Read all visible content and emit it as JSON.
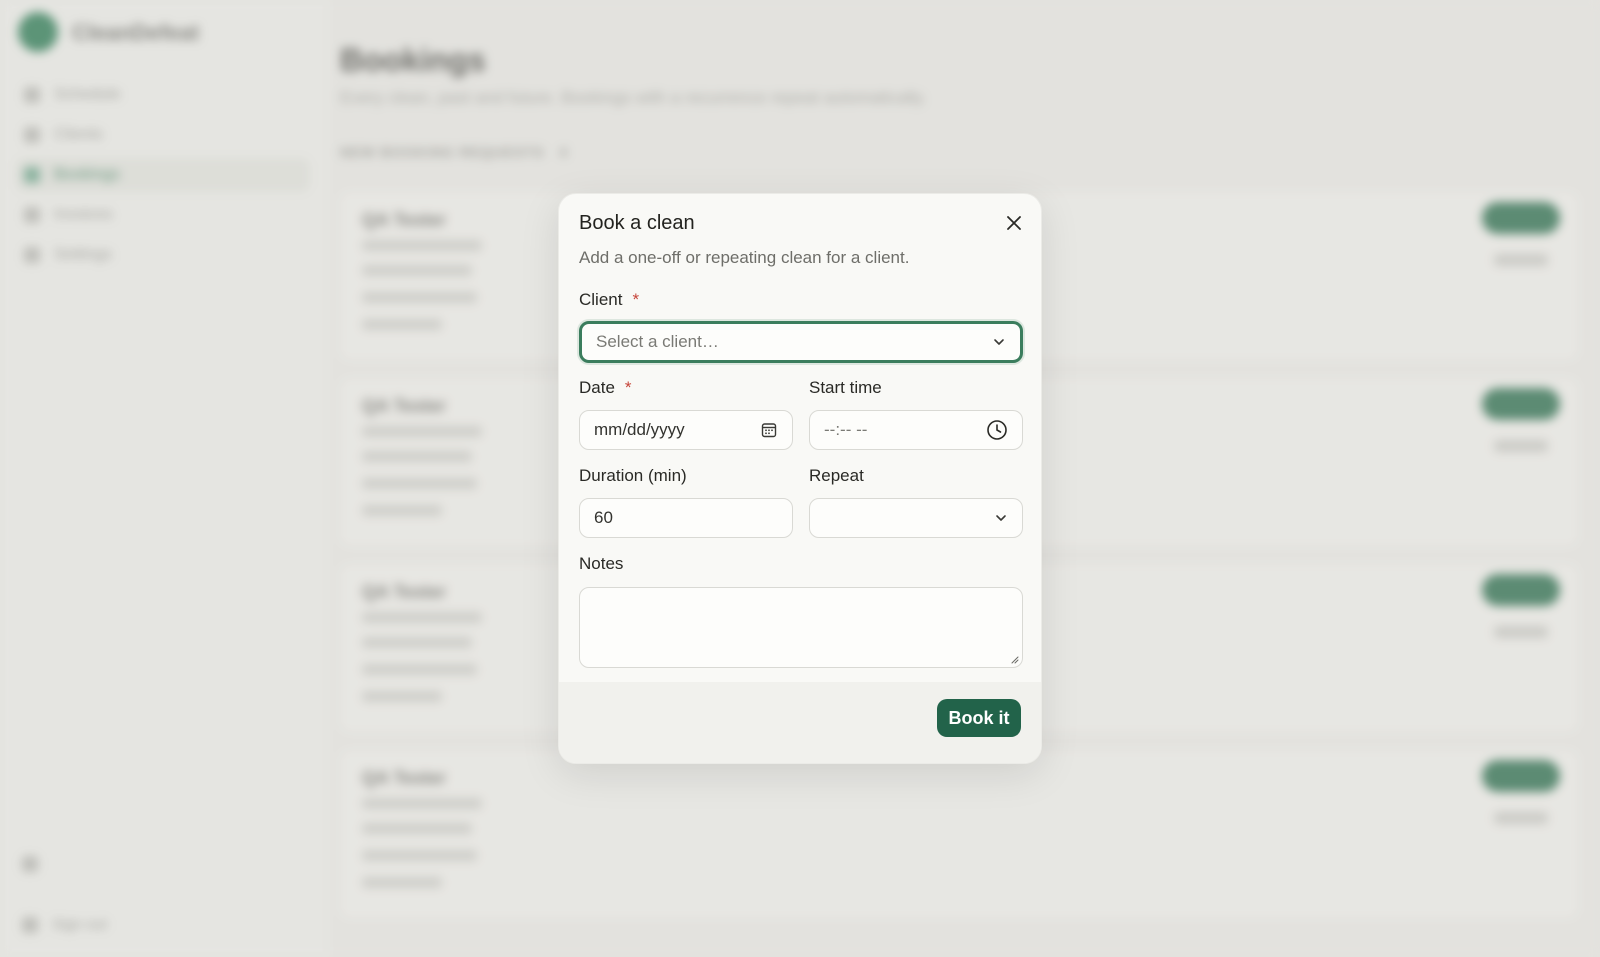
{
  "app": {
    "brand": "CleanDefeat",
    "nav": [
      {
        "label": "Schedule"
      },
      {
        "label": "Clients"
      },
      {
        "label": "Bookings"
      },
      {
        "label": "Invoices"
      },
      {
        "label": "Settings"
      }
    ],
    "signout": "Sign out"
  },
  "page": {
    "title": "Bookings",
    "subtitle": "Every clean, past and future. Bookings with a recurrence repeat automatically.",
    "section_label": "NEW BOOKING REQUESTS",
    "section_count": "4",
    "cards": [
      {
        "name": "QA Tester"
      },
      {
        "name": "QA Tester"
      },
      {
        "name": "QA Tester"
      },
      {
        "name": "QA Tester"
      }
    ]
  },
  "modal": {
    "title": "Book a clean",
    "subtitle": "Add a one-off or repeating clean for a client.",
    "client_label": "Client",
    "client_placeholder": "Select a client…",
    "date_label": "Date",
    "date_placeholder": "mm/dd/yyyy",
    "start_time_label": "Start time",
    "start_time_placeholder": "--:-- --",
    "duration_label": "Duration (min)",
    "duration_value": "60",
    "repeat_label": "Repeat",
    "repeat_value": "",
    "notes_label": "Notes",
    "notes_value": "",
    "required_mark": "*",
    "submit_label": "Book it"
  },
  "colors": {
    "accent": "#22634a",
    "focus_ring": "#3b7d5d",
    "required": "#c6453a"
  }
}
